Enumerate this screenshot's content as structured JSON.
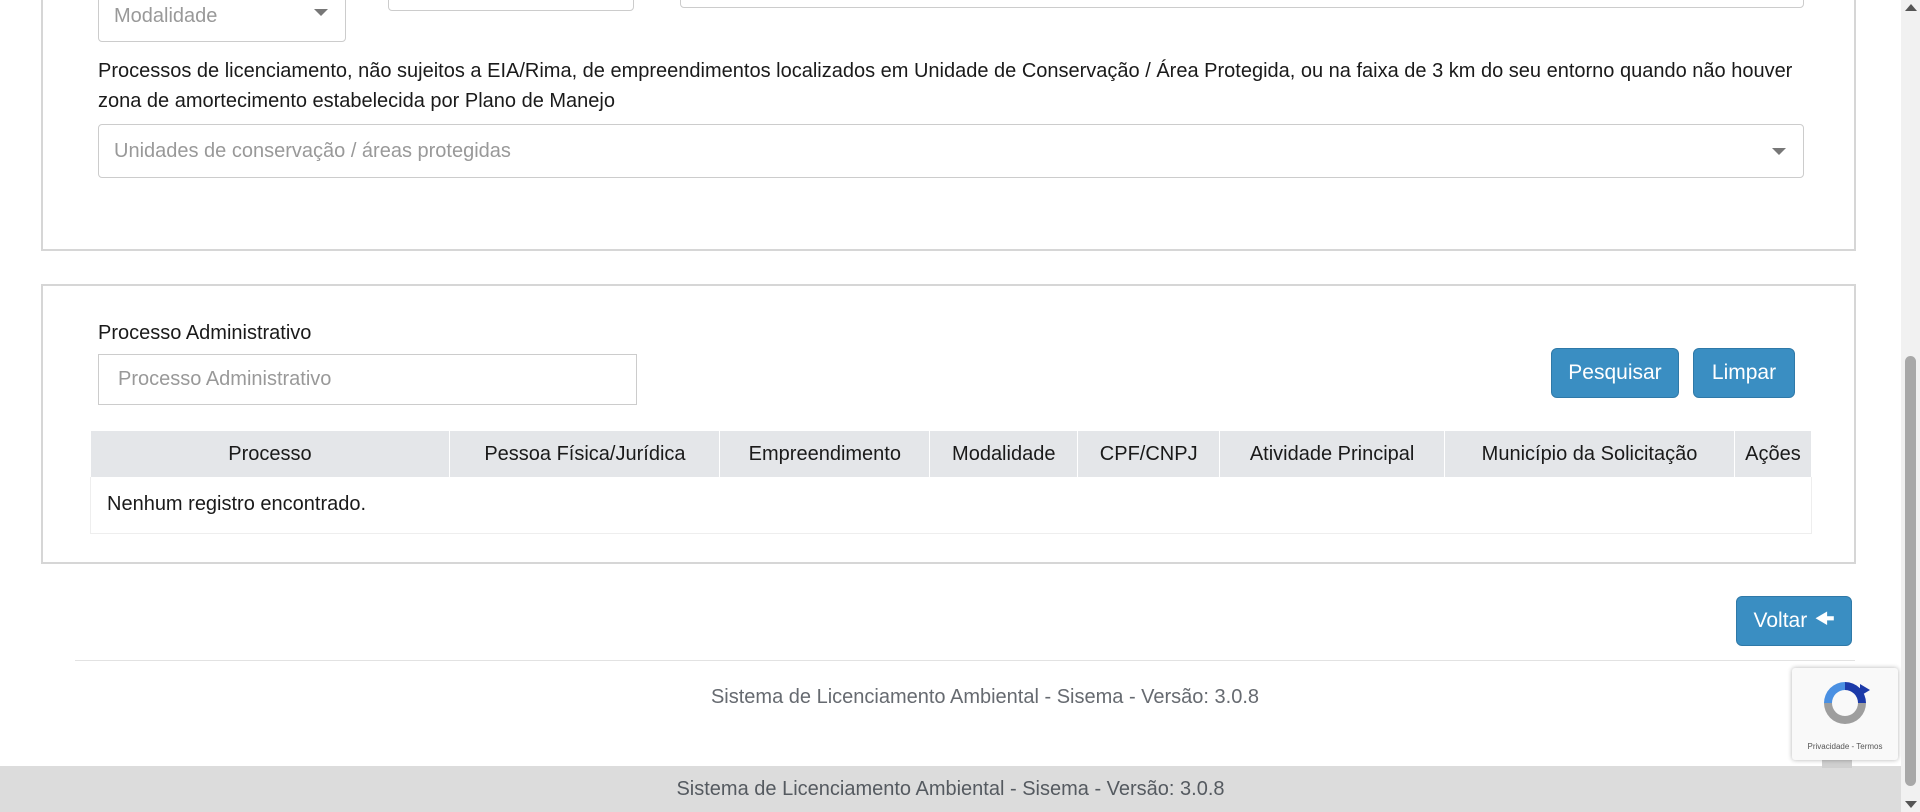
{
  "filters": {
    "modalidade_placeholder": "Modalidade",
    "uc_label": "Processos de licenciamento, não sujeitos a EIA/Rima, de empreendimentos localizados em Unidade de Conservação / Área Protegida, ou na faixa de 3 km do seu entorno quando não houver zona de amortecimento estabelecida por Plano de Manejo",
    "uc_placeholder": "Unidades de conservação / áreas protegidas"
  },
  "search": {
    "label": "Processo Administrativo",
    "placeholder": "Processo Administrativo",
    "pesquisar_label": "Pesquisar",
    "limpar_label": "Limpar"
  },
  "table": {
    "columns": [
      "Processo",
      "Pessoa Física/Jurídica",
      "Empreendimento",
      "Modalidade",
      "CPF/CNPJ",
      "Atividade Principal",
      "Município da Solicitação",
      "Ações"
    ],
    "empty_message": "Nenhum registro encontrado."
  },
  "voltar_label": "Voltar",
  "footer": {
    "text": "Sistema de Licenciamento Ambiental - Sisema - Versão: 3.0.8",
    "bar_text": "Sistema de Licenciamento Ambiental - Sisema - Versão: 3.0.8"
  },
  "recaptcha": {
    "links": "Privacidade - Termos"
  },
  "colors": {
    "primary_button": "#3a8ec2",
    "table_header": "#e4e6e9",
    "footer_bar": "#dcdcdc"
  }
}
